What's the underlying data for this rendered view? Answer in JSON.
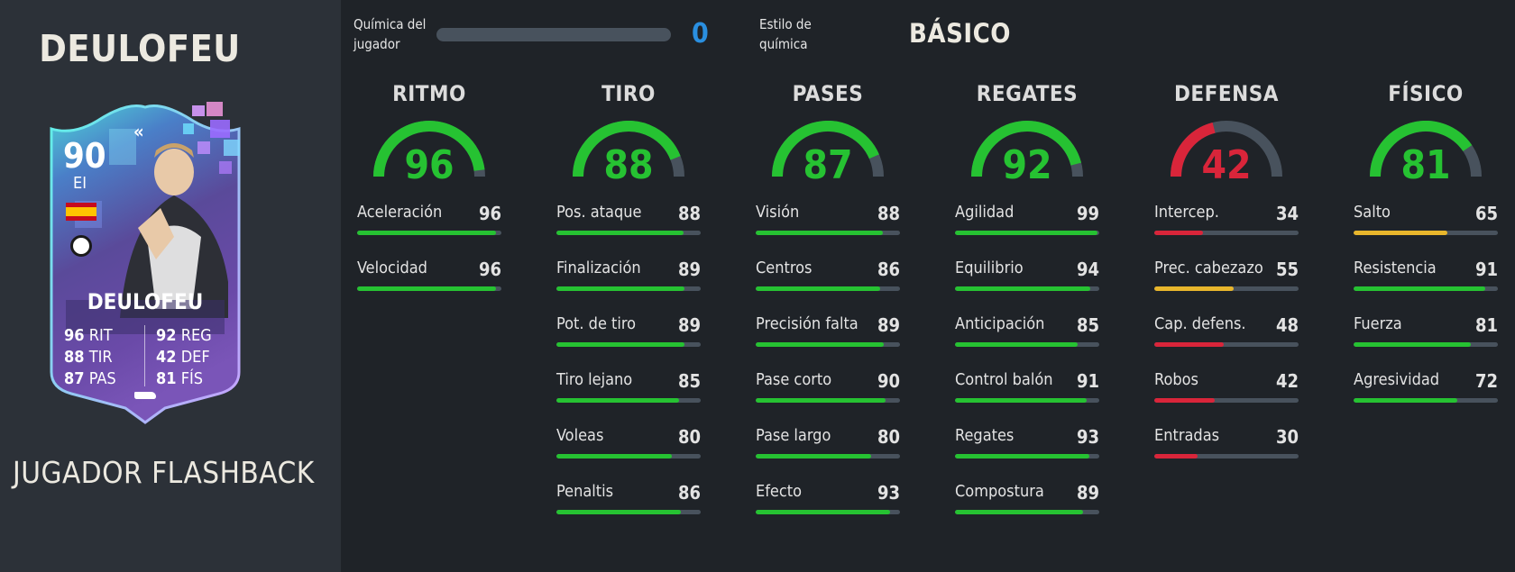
{
  "player": {
    "name": "DEULOFEU",
    "card_type": "JUGADOR FLASHBACK",
    "card": {
      "rating": "90",
      "position": "EI",
      "name": "DEULOFEU",
      "flag_icon": "spain-flag-icon",
      "club_icon": "udinese-badge-icon",
      "stats_left": [
        {
          "value": "96",
          "label": "RIT"
        },
        {
          "value": "88",
          "label": "TIR"
        },
        {
          "value": "87",
          "label": "PAS"
        }
      ],
      "stats_right": [
        {
          "value": "92",
          "label": "REG"
        },
        {
          "value": "42",
          "label": "DEF"
        },
        {
          "value": "81",
          "label": "FÍS"
        }
      ]
    }
  },
  "chemistry": {
    "label_line1": "Química del",
    "label_line2": "jugador",
    "value": "0",
    "value_fraction": 0,
    "style_label_line1": "Estilo de",
    "style_label_line2": "química",
    "style_value": "BÁSICO"
  },
  "colors": {
    "green": "#26c232",
    "yellow": "#e8b62c",
    "red": "#d9253a",
    "track": "#48525d",
    "chem_blue": "#2a8fe0"
  },
  "columns": [
    {
      "title": "RITMO",
      "value": "96",
      "color": "green",
      "stats": [
        {
          "label": "Aceleración",
          "value": "96",
          "color": "green"
        },
        {
          "label": "Velocidad",
          "value": "96",
          "color": "green"
        }
      ]
    },
    {
      "title": "TIRO",
      "value": "88",
      "color": "green",
      "stats": [
        {
          "label": "Pos. ataque",
          "value": "88",
          "color": "green"
        },
        {
          "label": "Finalización",
          "value": "89",
          "color": "green"
        },
        {
          "label": "Pot. de tiro",
          "value": "89",
          "color": "green"
        },
        {
          "label": "Tiro lejano",
          "value": "85",
          "color": "green"
        },
        {
          "label": "Voleas",
          "value": "80",
          "color": "green"
        },
        {
          "label": "Penaltis",
          "value": "86",
          "color": "green"
        }
      ]
    },
    {
      "title": "PASES",
      "value": "87",
      "color": "green",
      "stats": [
        {
          "label": "Visión",
          "value": "88",
          "color": "green"
        },
        {
          "label": "Centros",
          "value": "86",
          "color": "green"
        },
        {
          "label": "Precisión falta",
          "value": "89",
          "color": "green"
        },
        {
          "label": "Pase corto",
          "value": "90",
          "color": "green"
        },
        {
          "label": "Pase largo",
          "value": "80",
          "color": "green"
        },
        {
          "label": "Efecto",
          "value": "93",
          "color": "green"
        }
      ]
    },
    {
      "title": "REGATES",
      "value": "92",
      "color": "green",
      "stats": [
        {
          "label": "Agilidad",
          "value": "99",
          "color": "green"
        },
        {
          "label": "Equilibrio",
          "value": "94",
          "color": "green"
        },
        {
          "label": "Anticipación",
          "value": "85",
          "color": "green"
        },
        {
          "label": "Control balón",
          "value": "91",
          "color": "green"
        },
        {
          "label": "Regates",
          "value": "93",
          "color": "green"
        },
        {
          "label": "Compostura",
          "value": "89",
          "color": "green"
        }
      ]
    },
    {
      "title": "DEFENSA",
      "value": "42",
      "color": "red",
      "stats": [
        {
          "label": "Intercep.",
          "value": "34",
          "color": "red"
        },
        {
          "label": "Prec. cabezazo",
          "value": "55",
          "color": "yellow"
        },
        {
          "label": "Cap. defens.",
          "value": "48",
          "color": "red"
        },
        {
          "label": "Robos",
          "value": "42",
          "color": "red"
        },
        {
          "label": "Entradas",
          "value": "30",
          "color": "red"
        }
      ]
    },
    {
      "title": "FÍSICO",
      "value": "81",
      "color": "green",
      "stats": [
        {
          "label": "Salto",
          "value": "65",
          "color": "yellow"
        },
        {
          "label": "Resistencia",
          "value": "91",
          "color": "green"
        },
        {
          "label": "Fuerza",
          "value": "81",
          "color": "green"
        },
        {
          "label": "Agresividad",
          "value": "72",
          "color": "green"
        }
      ]
    }
  ]
}
